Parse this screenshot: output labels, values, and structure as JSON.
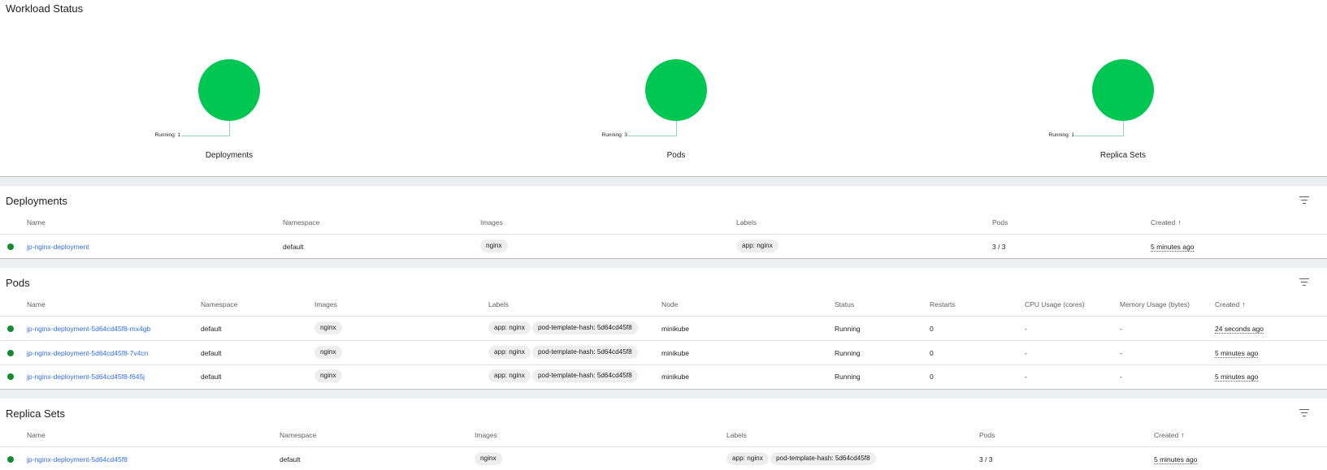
{
  "workload_status": {
    "title": "Workload Status",
    "charts": [
      {
        "label": "Deployments",
        "running": "Running: 1"
      },
      {
        "label": "Pods",
        "running": "Running: 3"
      },
      {
        "label": "Replica Sets",
        "running": "Running: 1"
      }
    ]
  },
  "colors": {
    "running": "#00c752",
    "status_dot": "#0f8d2c",
    "link": "#326de6"
  },
  "deployments": {
    "title": "Deployments",
    "columns": [
      "Name",
      "Namespace",
      "Images",
      "Labels",
      "Pods",
      "Created"
    ],
    "rows": [
      {
        "name": "jp-nginx-deployment",
        "namespace": "default",
        "image": "nginx",
        "labels": [
          "app: nginx"
        ],
        "pods": "3 / 3",
        "created": "5 minutes ago"
      }
    ]
  },
  "pods": {
    "title": "Pods",
    "columns": [
      "Name",
      "Namespace",
      "Images",
      "Labels",
      "Node",
      "Status",
      "Restarts",
      "CPU Usage (cores)",
      "Memory Usage (bytes)",
      "Created"
    ],
    "rows": [
      {
        "name": "jp-nginx-deployment-5d64cd45f8-mx4gb",
        "namespace": "default",
        "image": "nginx",
        "labels": [
          "app: nginx",
          "pod-template-hash: 5d64cd45f8"
        ],
        "node": "minikube",
        "status": "Running",
        "restarts": "0",
        "cpu": "-",
        "memory": "-",
        "created": "24 seconds ago"
      },
      {
        "name": "jp-nginx-deployment-5d64cd45f8-7v4cn",
        "namespace": "default",
        "image": "nginx",
        "labels": [
          "app: nginx",
          "pod-template-hash: 5d64cd45f8"
        ],
        "node": "minikube",
        "status": "Running",
        "restarts": "0",
        "cpu": "-",
        "memory": "-",
        "created": "5 minutes ago"
      },
      {
        "name": "jp-nginx-deployment-5d64cd45f8-f645j",
        "namespace": "default",
        "image": "nginx",
        "labels": [
          "app: nginx",
          "pod-template-hash: 5d64cd45f8"
        ],
        "node": "minikube",
        "status": "Running",
        "restarts": "0",
        "cpu": "-",
        "memory": "-",
        "created": "5 minutes ago"
      }
    ]
  },
  "replica_sets": {
    "title": "Replica Sets",
    "columns": [
      "Name",
      "Namespace",
      "Images",
      "Labels",
      "Pods",
      "Created"
    ],
    "rows": [
      {
        "name": "jp-nginx-deployment-5d64cd45f8",
        "namespace": "default",
        "image": "nginx",
        "labels": [
          "app: nginx",
          "pod-template-hash: 5d64cd45f8"
        ],
        "pods": "3 / 3",
        "created": "5 minutes ago"
      }
    ]
  },
  "icons": {
    "filter": "filter-list-icon",
    "sort": "arrow-upward-icon",
    "status": "status-dot-icon"
  }
}
